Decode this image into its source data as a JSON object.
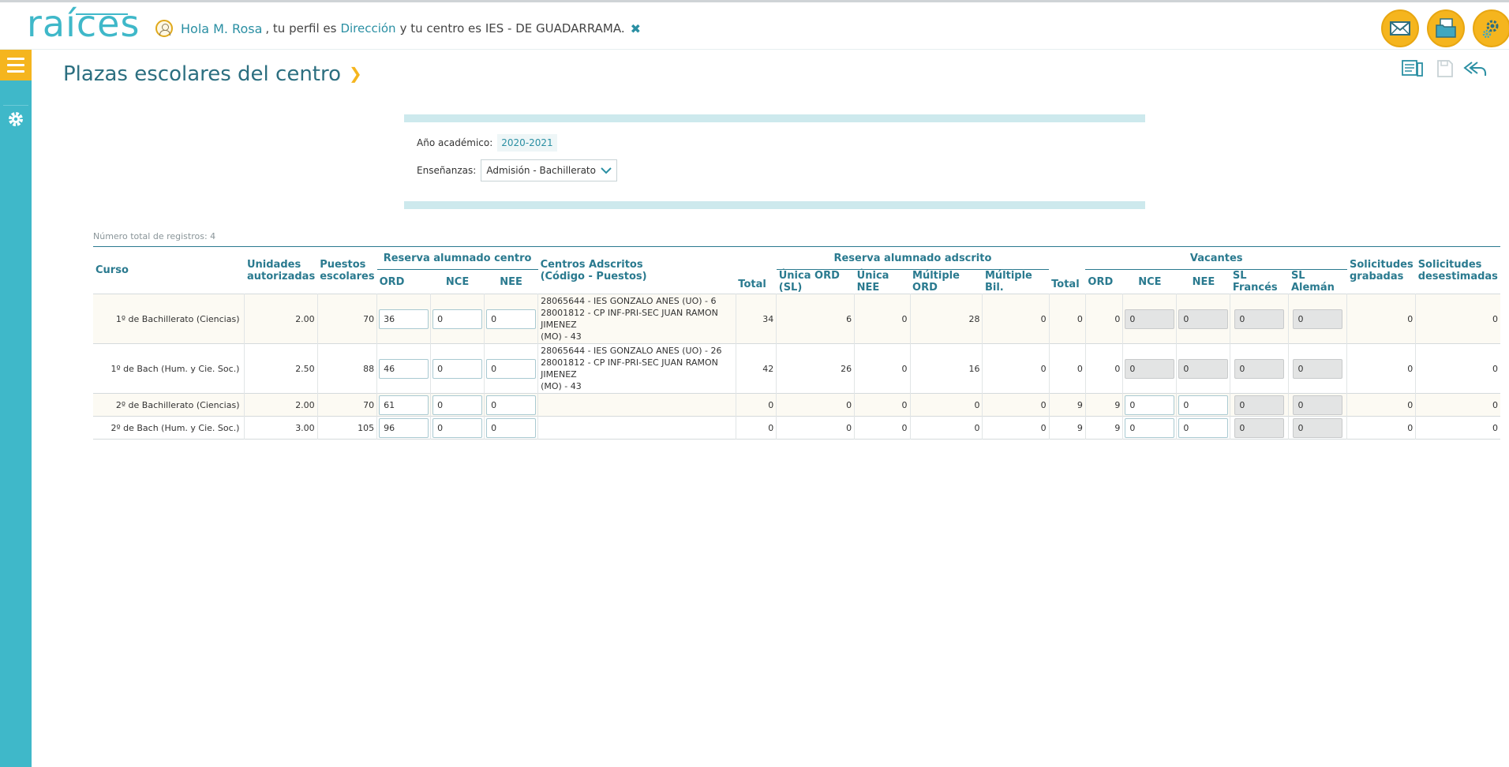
{
  "header": {
    "logo_text": "raíces",
    "greeting_prefix": "Hola",
    "user_name": "M. Rosa",
    "profile_text": ", tu perfil es",
    "profile": "Dirección",
    "center_text": "y tu centro es IES - DE GUADARRAMA.",
    "icons": [
      "user-icon",
      "close-icon",
      "mail-icon",
      "documents-icon",
      "settings-icon"
    ]
  },
  "page": {
    "title": "Plazas escolares del centro",
    "title_arrow": "›"
  },
  "filters": {
    "year_label": "Año académico:",
    "year_value": "2020-2021",
    "ensenanzas_label": "Enseñanzas:",
    "ensenanzas_value": "Admisión - Bachillerato"
  },
  "table": {
    "record_count": "Número total de registros: 4",
    "headers": {
      "curso": "Curso",
      "unidades": "Unidades autorizadas",
      "puestos": "Puestos escolares",
      "reserva_centro": "Reserva alumnado centro",
      "ord": "ORD",
      "nce": "NCE",
      "nee": "NEE",
      "centros_adscritos_1": "Centros Adscritos",
      "centros_adscritos_2": "(Código - Puestos)",
      "total": "Total",
      "reserva_adscrito": "Reserva alumnado adscrito",
      "unica_ord": "Única ORD (SL)",
      "unica_nee": "Única NEE",
      "multiple_ord": "Múltiple ORD",
      "multiple_bil": "Múltiple Bil.",
      "total2": "Total",
      "vacantes": "Vacantes",
      "v_ord": "ORD",
      "v_nce": "NCE",
      "v_nee": "NEE",
      "sl_frances": "SL Francés",
      "sl_aleman": "SL Alemán",
      "sol_grabadas": "Solicitudes grabadas",
      "sol_desestimadas": "Solicitudes desestimadas"
    },
    "rows": [
      {
        "curso": "1º de Bachillerato (Ciencias)",
        "unidades": "2.00",
        "puestos": "70",
        "ord": "36",
        "nce": "0",
        "nee": "0",
        "centros_1": "28065644 - IES GONZALO ANES (UO) - 6",
        "centros_2": "28001812 - CP INF-PRI-SEC JUAN RAMON JIMENEZ",
        "centros_3": "(MO) - 43",
        "total": "34",
        "unica_ord": "6",
        "unica_nee": "0",
        "multiple_ord": "28",
        "multiple_bil": "0",
        "total2": "0",
        "v_ord": "0",
        "v_nce": "0",
        "v_nee": "0",
        "sl_frances": "0",
        "sl_aleman": "0",
        "sol_grabadas": "0",
        "sol_desestimadas": "0"
      },
      {
        "curso": "1º de Bach (Hum. y Cie. Soc.)",
        "unidades": "2.50",
        "puestos": "88",
        "ord": "46",
        "nce": "0",
        "nee": "0",
        "centros_1": "28065644 - IES GONZALO ANES (UO) - 26",
        "centros_2": "28001812 - CP INF-PRI-SEC JUAN RAMON JIMENEZ",
        "centros_3": "(MO) - 43",
        "total": "42",
        "unica_ord": "26",
        "unica_nee": "0",
        "multiple_ord": "16",
        "multiple_bil": "0",
        "total2": "0",
        "v_ord": "0",
        "v_nce": "0",
        "v_nee": "0",
        "sl_frances": "0",
        "sl_aleman": "0",
        "sol_grabadas": "0",
        "sol_desestimadas": "0"
      },
      {
        "curso": "2º de Bachillerato (Ciencias)",
        "unidades": "2.00",
        "puestos": "70",
        "ord": "61",
        "nce": "0",
        "nee": "0",
        "total": "0",
        "unica_ord": "0",
        "unica_nee": "0",
        "multiple_ord": "0",
        "multiple_bil": "0",
        "total2": "9",
        "v_ord": "9",
        "v_nce": "0",
        "v_nee": "0",
        "sl_frances": "0",
        "sl_aleman": "0",
        "sol_grabadas": "0",
        "sol_desestimadas": "0"
      },
      {
        "curso": "2º de Bach (Hum. y Cie. Soc.)",
        "unidades": "3.00",
        "puestos": "105",
        "ord": "96",
        "nce": "0",
        "nee": "0",
        "total": "0",
        "unica_ord": "0",
        "unica_nee": "0",
        "multiple_ord": "0",
        "multiple_bil": "0",
        "total2": "9",
        "v_ord": "9",
        "v_nce": "0",
        "v_nee": "0",
        "sl_frances": "0",
        "sl_aleman": "0",
        "sol_grabadas": "0",
        "sol_desestimadas": "0"
      }
    ]
  }
}
